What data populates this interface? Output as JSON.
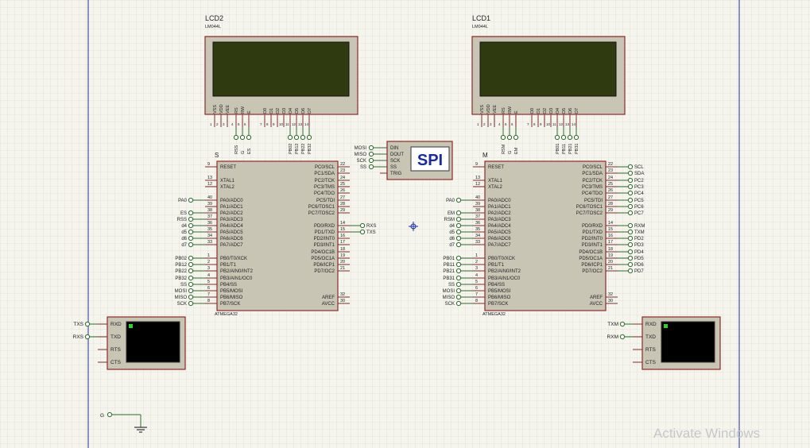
{
  "lcd_left": {
    "title": "LCD2",
    "model": "LM044L",
    "pins": [
      "VSS",
      "VDD",
      "VEE",
      "RS",
      "RW",
      "E",
      "D0",
      "D1",
      "D2",
      "D3",
      "D4",
      "D5",
      "D6",
      "D7"
    ],
    "nums": [
      "1",
      "2",
      "3",
      "4",
      "5",
      "6",
      "7",
      "8",
      "9",
      "10",
      "11",
      "12",
      "13",
      "14"
    ],
    "nets": [
      "RSS",
      "G",
      "ES",
      "PB02",
      "PB12",
      "PB22",
      "PB32"
    ]
  },
  "lcd_right": {
    "title": "LCD1",
    "model": "LM044L",
    "pins": [
      "VSS",
      "VDD",
      "VEE",
      "RS",
      "RW",
      "E",
      "D0",
      "D1",
      "D2",
      "D3",
      "D4",
      "D5",
      "D6",
      "D7"
    ],
    "nums": [
      "1",
      "2",
      "3",
      "4",
      "5",
      "6",
      "7",
      "8",
      "9",
      "10",
      "11",
      "12",
      "13",
      "14"
    ],
    "nets": [
      "RSM",
      "G",
      "EM",
      "PB01",
      "PB11",
      "PB21",
      "PB31"
    ]
  },
  "mcu_left": {
    "ref": "S",
    "part": "ATMEGA32"
  },
  "mcu_right": {
    "ref": "M",
    "part": "ATMEGA32"
  },
  "mcu_left_pins": [
    {
      "n": "9",
      "name": "RESET",
      "net": ""
    },
    {
      "n": "13",
      "name": "XTAL1",
      "net": ""
    },
    {
      "n": "12",
      "name": "XTAL2",
      "net": ""
    },
    {
      "n": "40",
      "name": "PA0/ADC0",
      "net": "PA0"
    },
    {
      "n": "39",
      "name": "PA1/ADC1",
      "net": ""
    },
    {
      "n": "38",
      "name": "PA2/ADC2",
      "net": "ES"
    },
    {
      "n": "37",
      "name": "PA3/ADC3",
      "net": "RSS"
    },
    {
      "n": "36",
      "name": "PA4/ADC4",
      "net": "d4"
    },
    {
      "n": "35",
      "name": "PA5/ADC5",
      "net": "d5"
    },
    {
      "n": "34",
      "name": "PA6/ADC6",
      "net": "d6"
    },
    {
      "n": "33",
      "name": "PA7/ADC7",
      "net": "d7"
    },
    {
      "n": "1",
      "name": "PB0/T0/XCK",
      "net": "PB02"
    },
    {
      "n": "2",
      "name": "PB1/T1",
      "net": "PB12"
    },
    {
      "n": "3",
      "name": "PB2/AIN0/INT2",
      "net": "PB22"
    },
    {
      "n": "4",
      "name": "PB3/AIN1/OC0",
      "net": "PB32"
    },
    {
      "n": "5",
      "name": "PB4/SS",
      "net": "SS"
    },
    {
      "n": "6",
      "name": "PB5/MOSI",
      "net": "MOSI"
    },
    {
      "n": "7",
      "name": "PB6/MISO",
      "net": "MISO"
    },
    {
      "n": "8",
      "name": "PB7/SCK",
      "net": "SCK"
    }
  ],
  "mcu_right_pins": [
    {
      "n": "9",
      "name": "RESET",
      "net": ""
    },
    {
      "n": "13",
      "name": "XTAL1",
      "net": ""
    },
    {
      "n": "12",
      "name": "XTAL2",
      "net": ""
    },
    {
      "n": "40",
      "name": "PA0/ADC0",
      "net": "PA0"
    },
    {
      "n": "39",
      "name": "PA1/ADC1",
      "net": ""
    },
    {
      "n": "38",
      "name": "PA2/ADC2",
      "net": "EM"
    },
    {
      "n": "37",
      "name": "PA3/ADC3",
      "net": "RSM"
    },
    {
      "n": "36",
      "name": "PA4/ADC4",
      "net": "d4"
    },
    {
      "n": "35",
      "name": "PA5/ADC5",
      "net": "d5"
    },
    {
      "n": "34",
      "name": "PA6/ADC6",
      "net": "d6"
    },
    {
      "n": "33",
      "name": "PA7/ADC7",
      "net": "d7"
    },
    {
      "n": "1",
      "name": "PB0/T0/XCK",
      "net": "PB01"
    },
    {
      "n": "2",
      "name": "PB1/T1",
      "net": "PB11"
    },
    {
      "n": "3",
      "name": "PB2/AIN0/INT2",
      "net": "PB21"
    },
    {
      "n": "4",
      "name": "PB3/AIN1/OC0",
      "net": "PB31"
    },
    {
      "n": "5",
      "name": "PB4/SS",
      "net": "SS"
    },
    {
      "n": "6",
      "name": "PB5/MOSI",
      "net": "MOSI"
    },
    {
      "n": "7",
      "name": "PB6/MISO",
      "net": "MISO"
    },
    {
      "n": "8",
      "name": "PB7/SCK",
      "net": "SCK"
    }
  ],
  "mcu_left_rpins": [
    {
      "n": "22",
      "name": "PC0/SCL",
      "net": ""
    },
    {
      "n": "23",
      "name": "PC1/SDA",
      "net": ""
    },
    {
      "n": "24",
      "name": "PC2/TCK",
      "net": ""
    },
    {
      "n": "25",
      "name": "PC3/TMS",
      "net": ""
    },
    {
      "n": "26",
      "name": "PC4/TDO",
      "net": ""
    },
    {
      "n": "27",
      "name": "PC5/TDI",
      "net": ""
    },
    {
      "n": "28",
      "name": "PC6/TOSC1",
      "net": ""
    },
    {
      "n": "29",
      "name": "PC7/TOSC2",
      "net": ""
    },
    {
      "n": "14",
      "name": "PD0/RXD",
      "net": "RXS"
    },
    {
      "n": "15",
      "name": "PD1/TXD",
      "net": "TXS"
    },
    {
      "n": "16",
      "name": "PD2/INT0",
      "net": ""
    },
    {
      "n": "17",
      "name": "PD3/INT1",
      "net": ""
    },
    {
      "n": "18",
      "name": "PD4/OC1B",
      "net": ""
    },
    {
      "n": "19",
      "name": "PD5/OC1A",
      "net": ""
    },
    {
      "n": "20",
      "name": "PD6/ICP1",
      "net": ""
    },
    {
      "n": "21",
      "name": "PD7/OC2",
      "net": ""
    },
    {
      "n": "32",
      "name": "AREF",
      "net": ""
    },
    {
      "n": "30",
      "name": "AVCC",
      "net": ""
    }
  ],
  "mcu_right_rpins": [
    {
      "n": "22",
      "name": "PC0/SCL",
      "net": "SCL"
    },
    {
      "n": "23",
      "name": "PC1/SDA",
      "net": "SDA"
    },
    {
      "n": "24",
      "name": "PC2/TCK",
      "net": "PC2"
    },
    {
      "n": "25",
      "name": "PC3/TMS",
      "net": "PC3"
    },
    {
      "n": "26",
      "name": "PC4/TDO",
      "net": "PC4"
    },
    {
      "n": "27",
      "name": "PC5/TDI",
      "net": "PC5"
    },
    {
      "n": "28",
      "name": "PC6/TOSC1",
      "net": "PC6"
    },
    {
      "n": "29",
      "name": "PC7/TOSC2",
      "net": "PC7"
    },
    {
      "n": "14",
      "name": "PD0/RXD",
      "net": "RXM"
    },
    {
      "n": "15",
      "name": "PD1/TXD",
      "net": "TXM"
    },
    {
      "n": "16",
      "name": "PD2/INT0",
      "net": "PD2"
    },
    {
      "n": "17",
      "name": "PD3/INT1",
      "net": "PD3"
    },
    {
      "n": "18",
      "name": "PD4/OC1B",
      "net": "PD4"
    },
    {
      "n": "19",
      "name": "PD5/OC1A",
      "net": "PD5"
    },
    {
      "n": "20",
      "name": "PD6/ICP1",
      "net": "PD6"
    },
    {
      "n": "21",
      "name": "PD7/OC2",
      "net": "PD7"
    },
    {
      "n": "32",
      "name": "AREF",
      "net": ""
    },
    {
      "n": "30",
      "name": "AVCC",
      "net": ""
    }
  ],
  "spi": {
    "title": "SPI",
    "pins": [
      "DIN",
      "DOUT",
      "SCK",
      "SS",
      "TRIG"
    ],
    "nets": [
      "MOSI",
      "MISO",
      "SCK",
      "SS"
    ]
  },
  "terminal_left": {
    "pins": [
      "RXD",
      "TXD",
      "RTS",
      "CTS"
    ],
    "nets": [
      "TXS",
      "RXS"
    ]
  },
  "terminal_right": {
    "pins": [
      "RXD",
      "TXD",
      "RTS",
      "CTS"
    ],
    "nets": [
      "TXM",
      "RXM"
    ]
  },
  "ground": {
    "label": "G"
  },
  "watermark": "Activate Windows",
  "colors": {
    "background": "#f5f5ee",
    "grid": "#dcdcd0",
    "body": "#c9c5b4",
    "outline": "#8c2a2a",
    "wire": "#2e6b2e",
    "lcd_screen": "#2f3a10",
    "spi_text": "#1a2b9a",
    "frame_line": "#2030a0"
  }
}
